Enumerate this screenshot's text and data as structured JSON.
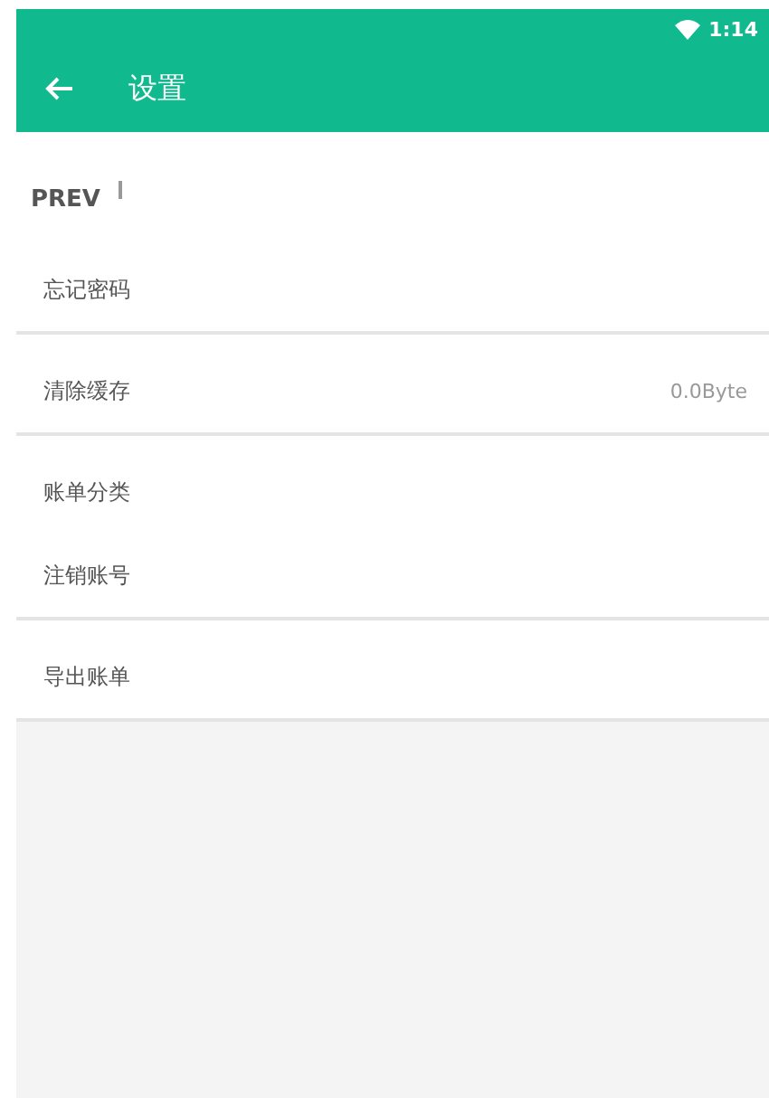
{
  "status_bar": {
    "time": "1:14"
  },
  "toolbar": {
    "title": "设置"
  },
  "section": {
    "title": "PREV"
  },
  "groups": [
    {
      "items": [
        {
          "label": "忘记密码"
        }
      ]
    },
    {
      "items": [
        {
          "label": "清除缓存",
          "value": "0.0Byte"
        }
      ]
    },
    {
      "items": [
        {
          "label": "账单分类"
        },
        {
          "label": "注销账号"
        }
      ]
    },
    {
      "items": [
        {
          "label": "导出账单"
        }
      ]
    }
  ]
}
